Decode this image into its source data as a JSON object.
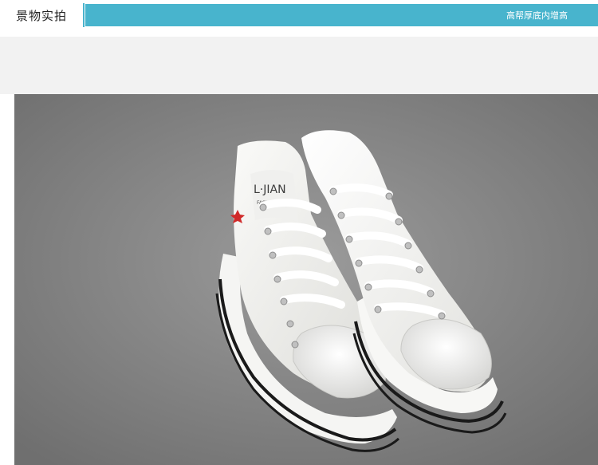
{
  "header": {
    "section_title": "景物实拍",
    "tagline": "高帮厚底内增高"
  },
  "photo": {
    "subject": "",
    "brand_text": "L·JIAN",
    "brand_sub": "FASHION"
  },
  "colors": {
    "accent": "#48b4cd",
    "carpet": "#8a8a8a",
    "shoe": "#f4f4f2",
    "sole_stripe": "#1a1a1a"
  }
}
